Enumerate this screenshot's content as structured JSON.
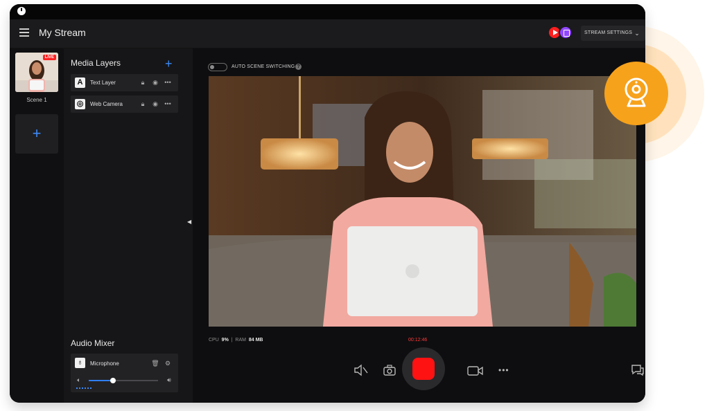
{
  "app": {
    "title": "My Stream"
  },
  "header": {
    "settings_label": "STREAM SETTINGS",
    "platforms": [
      "youtube-icon",
      "twitch-icon"
    ]
  },
  "scenes": {
    "items": [
      {
        "label": "Scene 1",
        "badge": "LIVE"
      }
    ]
  },
  "media_layers": {
    "title": "Media Layers",
    "items": [
      {
        "label": "Text Layer",
        "icon": "text-layer-icon",
        "glyph": "A"
      },
      {
        "label": "Web Camera",
        "icon": "web-camera-icon",
        "glyph": "◎"
      }
    ]
  },
  "audio_mixer": {
    "title": "Audio Mixer",
    "items": [
      {
        "label": "Microphone",
        "volume": 0.35
      }
    ]
  },
  "stage": {
    "auto_scene_label": "AUTO SCENE SWITCHING",
    "auto_scene_enabled": false,
    "stats": {
      "cpu_label": "CPU",
      "cpu_value": "9%",
      "ram_label": "RAM",
      "ram_value": "84 MB"
    },
    "timer": "00:12:46"
  },
  "colors": {
    "accent": "#3d8af7",
    "record": "#ff1212",
    "badge": "#f7a21b",
    "live": "#ff2020"
  }
}
